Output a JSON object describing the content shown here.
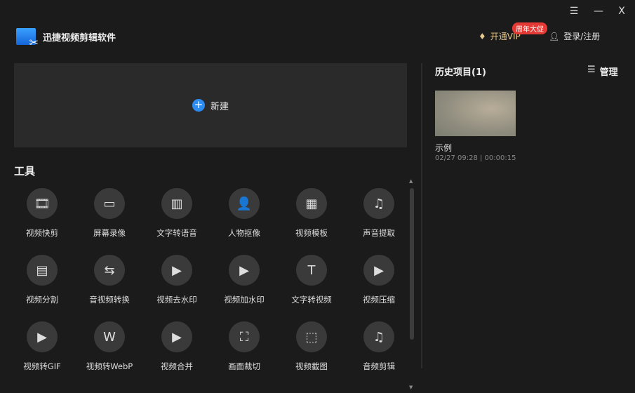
{
  "window": {
    "menu_icon": "☰",
    "minimize_icon": "—",
    "close_icon": "X"
  },
  "app": {
    "title": "迅捷视频剪辑软件"
  },
  "header": {
    "vip_label": "开通VIP",
    "promo_badge": "周年大促",
    "login_label": "登录/注册"
  },
  "main": {
    "new_label": "新建",
    "tools_heading": "工具",
    "tools": [
      {
        "label": "视频快剪",
        "icon": "🎞"
      },
      {
        "label": "屏幕录像",
        "icon": "▭"
      },
      {
        "label": "文字转语音",
        "icon": "▥"
      },
      {
        "label": "人物抠像",
        "icon": "👤"
      },
      {
        "label": "视频模板",
        "icon": "▦"
      },
      {
        "label": "声音提取",
        "icon": "♫"
      },
      {
        "label": "视频分割",
        "icon": "▤"
      },
      {
        "label": "音视频转换",
        "icon": "⇆"
      },
      {
        "label": "视频去水印",
        "icon": "▶"
      },
      {
        "label": "视频加水印",
        "icon": "▶"
      },
      {
        "label": "文字转视频",
        "icon": "T"
      },
      {
        "label": "视频压缩",
        "icon": "▶"
      },
      {
        "label": "视频转GIF",
        "icon": "▶"
      },
      {
        "label": "视频转WebP",
        "icon": "W"
      },
      {
        "label": "视频合并",
        "icon": "▶"
      },
      {
        "label": "画面裁切",
        "icon": "⛶"
      },
      {
        "label": "视频截图",
        "icon": "⬚"
      },
      {
        "label": "音频剪辑",
        "icon": "♫"
      }
    ]
  },
  "history": {
    "heading": "历史项目(1)",
    "manage_label": "管理",
    "projects": [
      {
        "name": "示例",
        "meta": "02/27 09:28 | 00:00:15"
      }
    ]
  }
}
